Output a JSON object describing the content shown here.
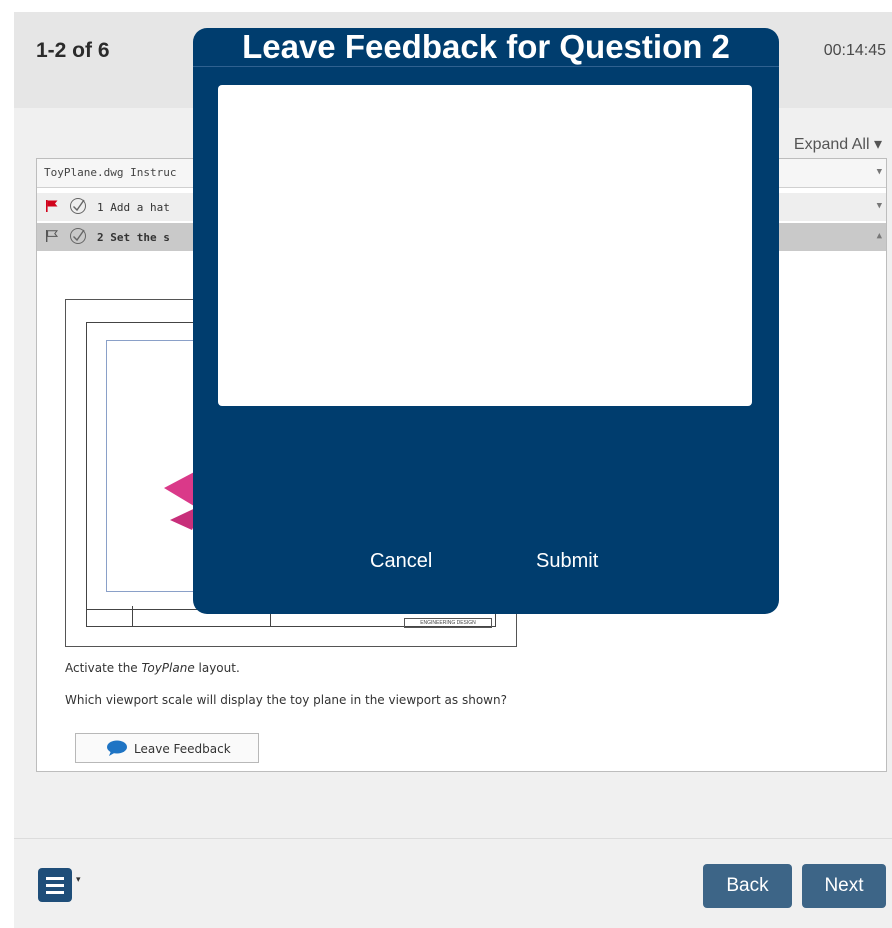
{
  "header": {
    "progress": "1-2 of 6",
    "timer": "00:14:45"
  },
  "toolbar": {
    "expand_all": "Expand All ▾"
  },
  "question_list": {
    "file_label": "ToyPlane.dwg Instruc",
    "items": [
      {
        "label": "1 Add a hat",
        "flagged": true
      },
      {
        "label": "2 Set the s",
        "flagged": false
      }
    ]
  },
  "question": {
    "drawing_title_block": "ENGINEERING DESIGN",
    "instruction_prefix": "Activate the ",
    "instruction_layout": "ToyPlane",
    "instruction_suffix": " layout.",
    "prompt": "Which viewport scale will display the toy plane in the viewport as shown?",
    "feedback_button": "Leave Feedback"
  },
  "footer": {
    "back_label": "Back",
    "next_label": "Next"
  },
  "modal": {
    "title": "Leave Feedback for Question 2",
    "textarea_value": "",
    "cancel_label": "Cancel",
    "submit_label": "Submit"
  },
  "colors": {
    "modal_bg": "#003d6e",
    "nav_button": "#3d6587",
    "flag_red": "#d0021b",
    "plane_magenta": "#d6247c"
  },
  "icons": {
    "flag_filled": "flag-icon",
    "flag_outline": "flag-outline-icon",
    "check": "checkmark-icon",
    "chat": "chat-bubble-icon",
    "menu": "hamburger-menu-icon"
  }
}
